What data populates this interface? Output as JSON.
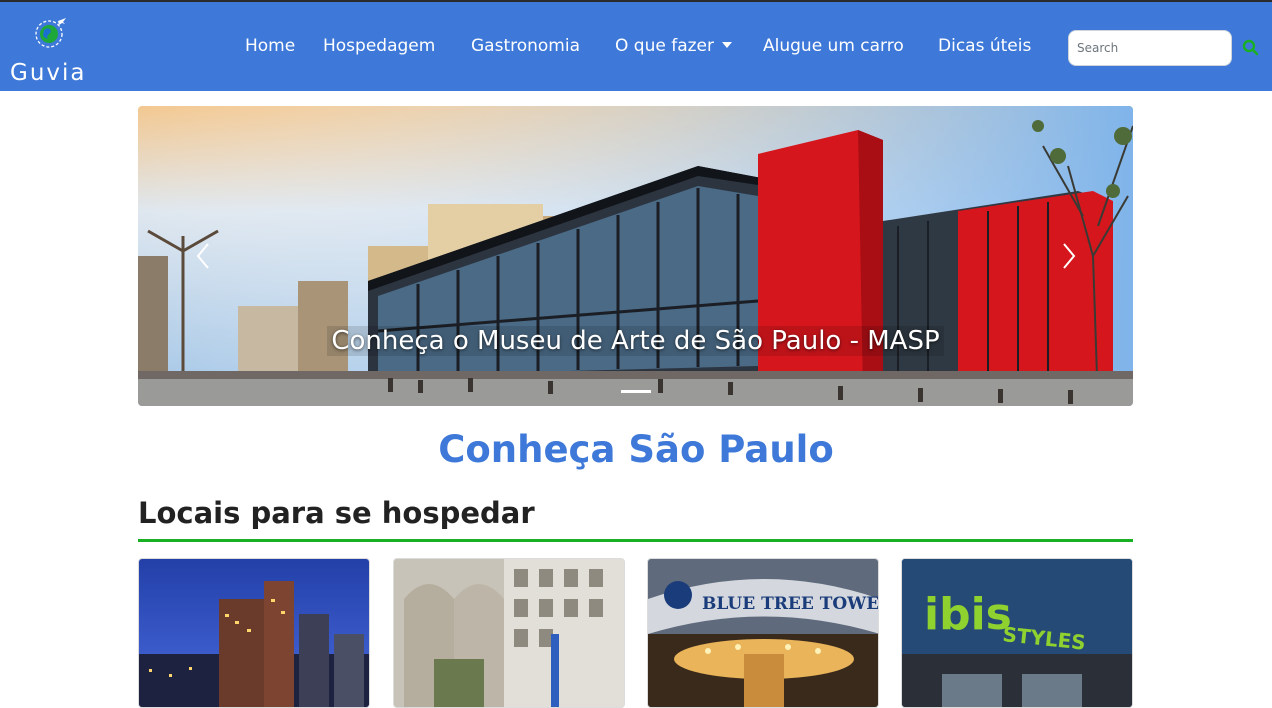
{
  "brand": {
    "name": "Guvia",
    "icon": "globe-plane-icon"
  },
  "nav": {
    "items": [
      {
        "label": "Home"
      },
      {
        "label": "Hospedagem"
      },
      {
        "label": "Gastronomia"
      },
      {
        "label": "O que fazer",
        "dropdown": true
      },
      {
        "label": "Alugue um carro"
      },
      {
        "label": "Dicas úteis"
      }
    ]
  },
  "search": {
    "placeholder": "Search",
    "value": "",
    "button_icon": "search-icon"
  },
  "carousel": {
    "caption": "Conheça o Museu de Arte de São Paulo - MASP",
    "prev_icon": "chevron-left-icon",
    "next_icon": "chevron-right-icon",
    "slides_count": 1,
    "active_slide": 1
  },
  "page_title": "Conheça São Paulo",
  "section": {
    "title": "Locais para se hospedar",
    "cards": [
      {
        "image": "hotel-night-tower"
      },
      {
        "image": "hotel-classic-facade"
      },
      {
        "image": "hotel-sign",
        "sign_text": "BLUE TREE TOWER"
      },
      {
        "image": "hotel-sign",
        "sign_text": "ibis",
        "sign_subtext": "STYLES"
      }
    ]
  },
  "colors": {
    "primary": "#3e78d8",
    "accent": "#19b024",
    "masp_red": "#d6161d"
  }
}
